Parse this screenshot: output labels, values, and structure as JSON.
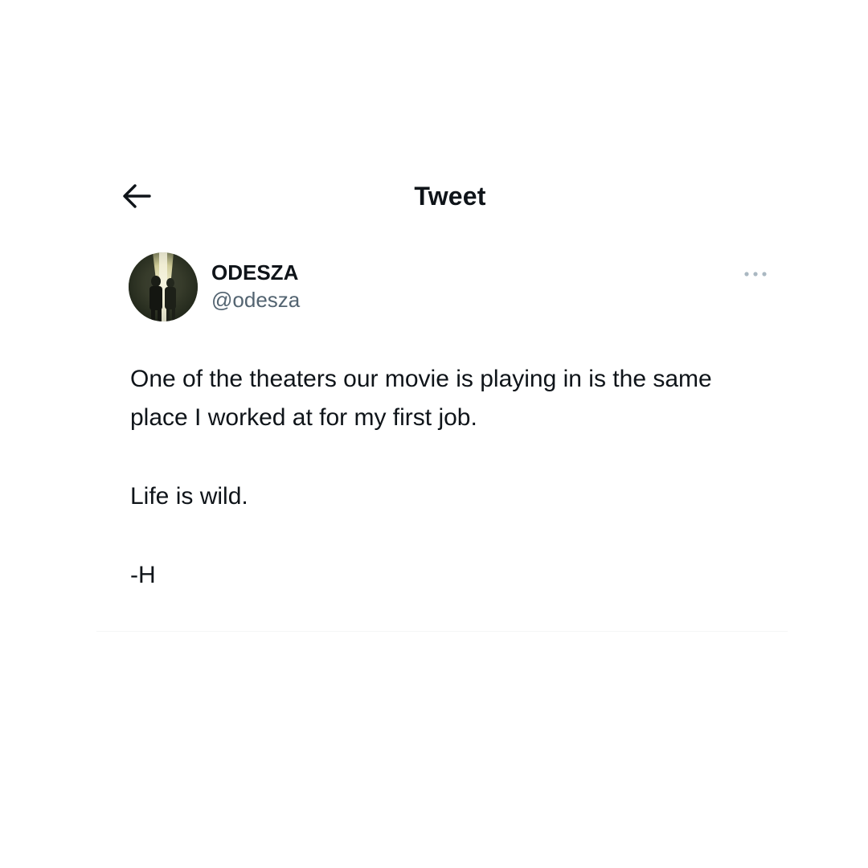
{
  "header": {
    "title": "Tweet",
    "back_icon": "arrow-left-icon"
  },
  "author": {
    "display_name": "ODESZA",
    "handle": "@odesza",
    "avatar": "avatar-photo",
    "more_icon": "more-horizontal-icon"
  },
  "tweet": {
    "paragraphs": [
      "One of the theaters our movie is playing in is the same place I worked at for my first job.",
      "Life is wild.",
      "-H"
    ]
  },
  "colors": {
    "text_primary": "#0f1419",
    "text_secondary": "#536471",
    "icon_muted": "#aab8c2",
    "background": "#ffffff"
  }
}
